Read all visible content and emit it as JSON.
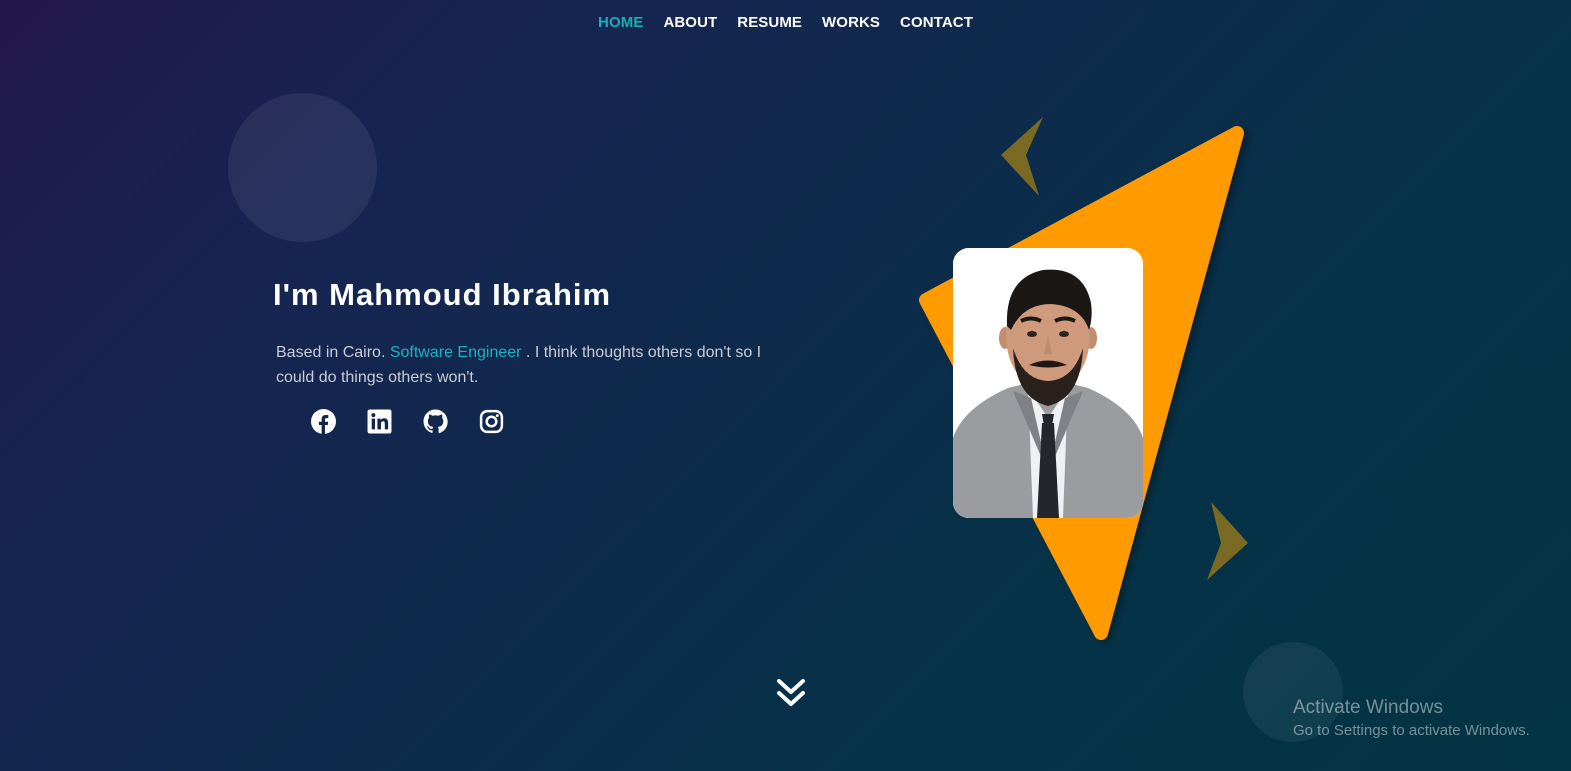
{
  "nav": {
    "items": [
      {
        "label": "HOME",
        "active": true
      },
      {
        "label": "ABOUT",
        "active": false
      },
      {
        "label": "RESUME",
        "active": false
      },
      {
        "label": "WORKS",
        "active": false
      },
      {
        "label": "CONTACT",
        "active": false
      }
    ]
  },
  "hero": {
    "title": "I'm Mahmoud Ibrahim",
    "desc_before": "Based in Cairo. ",
    "desc_accent": "Software Engineer",
    "desc_after": " . I think thoughts others don't so I could do things others won't."
  },
  "social": [
    {
      "icon": "facebook-icon"
    },
    {
      "icon": "linkedin-icon"
    },
    {
      "icon": "github-icon"
    },
    {
      "icon": "instagram-icon"
    }
  ],
  "scroll": {
    "icon": "double-chevron-down-icon"
  },
  "watermark": {
    "line1": "Activate Windows",
    "line2": "Go to Settings to activate Windows."
  },
  "colors": {
    "accent": "#17b0b6",
    "triangle": "#ff9a00",
    "arrow": "#7a6a24"
  }
}
